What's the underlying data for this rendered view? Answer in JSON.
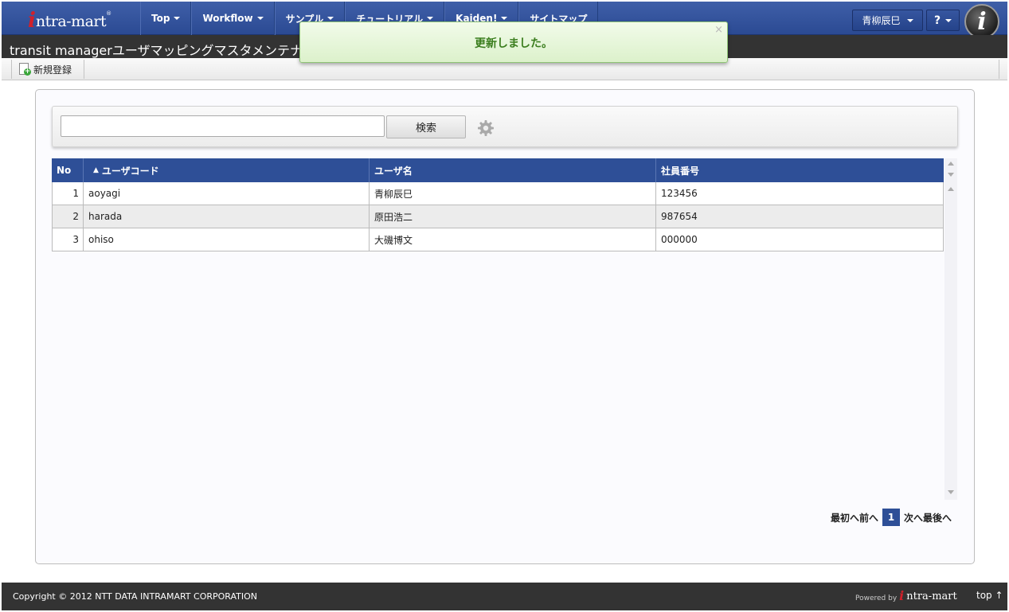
{
  "header": {
    "logo_i": "i",
    "logo_text": "ntra-mart",
    "logo_reg": "®",
    "menu": [
      {
        "label": "Top"
      },
      {
        "label": "Workflow"
      },
      {
        "label": "サンプル"
      },
      {
        "label": "チュートリアル"
      },
      {
        "label": "Kaiden!"
      },
      {
        "label": "サイトマップ"
      }
    ],
    "user_name": "青柳辰巳",
    "help_label": "?",
    "brand_letter": "i"
  },
  "page": {
    "title": "transit managerユーザマッピングマスタメンテナンス"
  },
  "toolbar": {
    "new_label": "新規登録"
  },
  "toast": {
    "message": "更新しました。",
    "close": "×"
  },
  "search": {
    "value": "",
    "placeholder": "",
    "button_label": "検索"
  },
  "grid": {
    "columns": [
      "No",
      "ユーザコード",
      "ユーザ名",
      "社員番号"
    ],
    "sort_indicator": "▲",
    "rows": [
      {
        "no": "1",
        "code": "aoyagi",
        "name": "青柳辰巳",
        "emp": "123456"
      },
      {
        "no": "2",
        "code": "harada",
        "name": "原田浩二",
        "emp": "987654"
      },
      {
        "no": "3",
        "code": "ohiso",
        "name": "大磯博文",
        "emp": "000000"
      }
    ]
  },
  "pager": {
    "first": "最初へ",
    "prev": "前へ",
    "current": "1",
    "next": "次へ",
    "last": "最後へ"
  },
  "footer": {
    "copyright": "Copyright © 2012 NTT DATA INTRAMART CORPORATION",
    "powered_by": "Powered by",
    "powered_i": "i",
    "powered_text": "ntra-mart",
    "top_link": "top ↑"
  }
}
